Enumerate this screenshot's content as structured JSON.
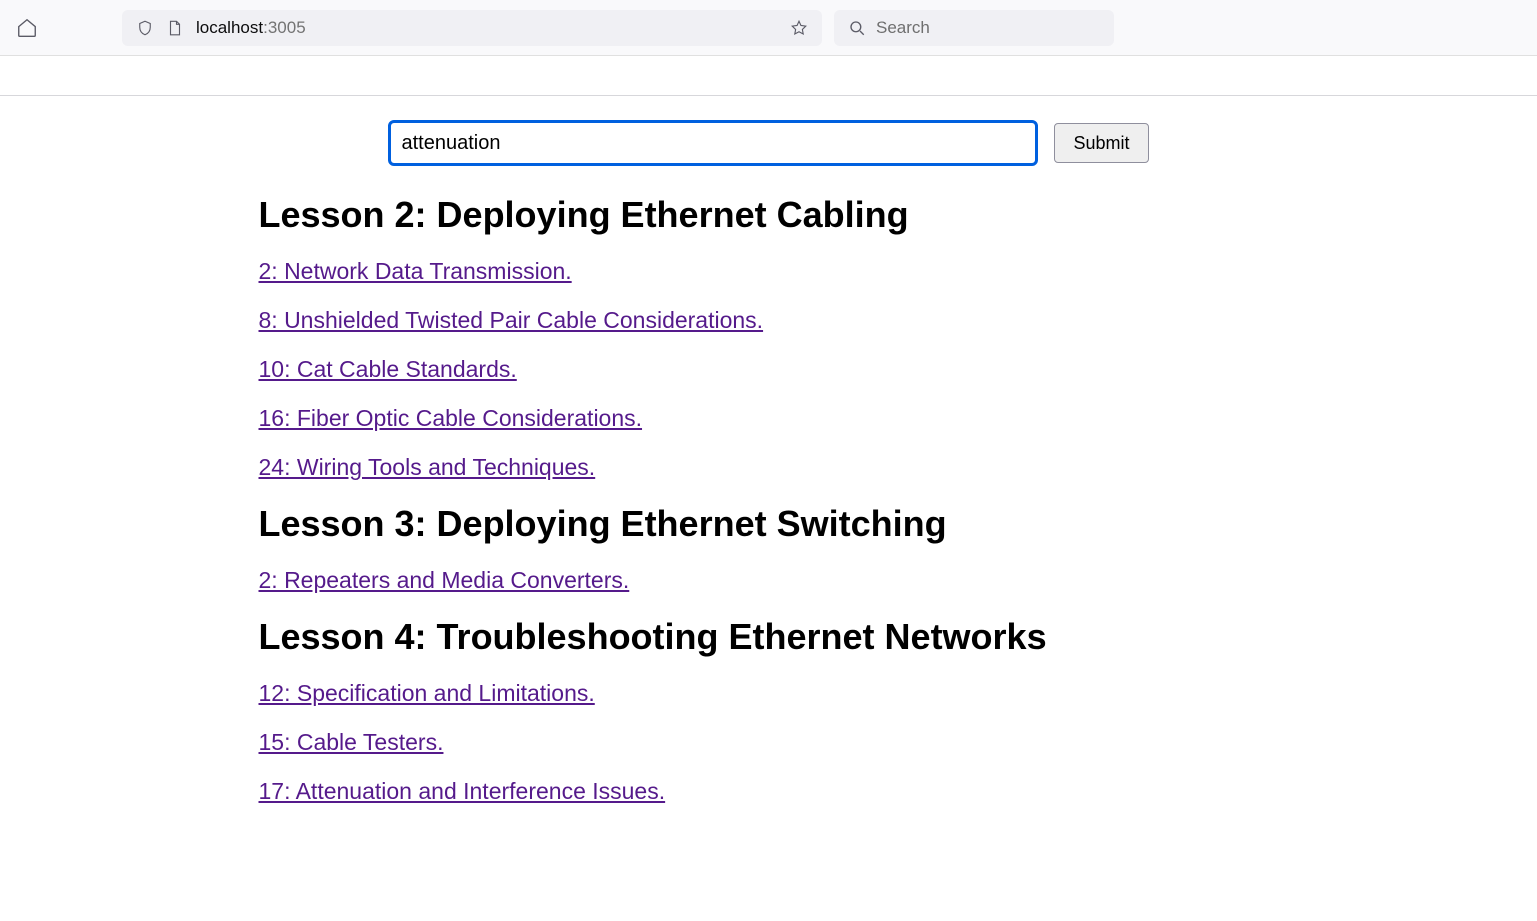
{
  "browser": {
    "url_host": "localhost",
    "url_port": ":3005",
    "search_placeholder": "Search"
  },
  "form": {
    "search_value": "attenuation",
    "submit_label": "Submit"
  },
  "sections": [
    {
      "heading": "Lesson 2: Deploying Ethernet Cabling",
      "links": [
        "2: Network Data Transmission.",
        "8: Unshielded Twisted Pair Cable Considerations.",
        "10: Cat Cable Standards.",
        "16: Fiber Optic Cable Considerations.",
        "24: Wiring Tools and Techniques."
      ]
    },
    {
      "heading": "Lesson 3: Deploying Ethernet Switching",
      "links": [
        "2: Repeaters and Media Converters."
      ]
    },
    {
      "heading": "Lesson 4: Troubleshooting Ethernet Networks",
      "links": [
        "12: Specification and Limitations.",
        "15: Cable Testers.",
        "17: Attenuation and Interference Issues."
      ]
    }
  ]
}
